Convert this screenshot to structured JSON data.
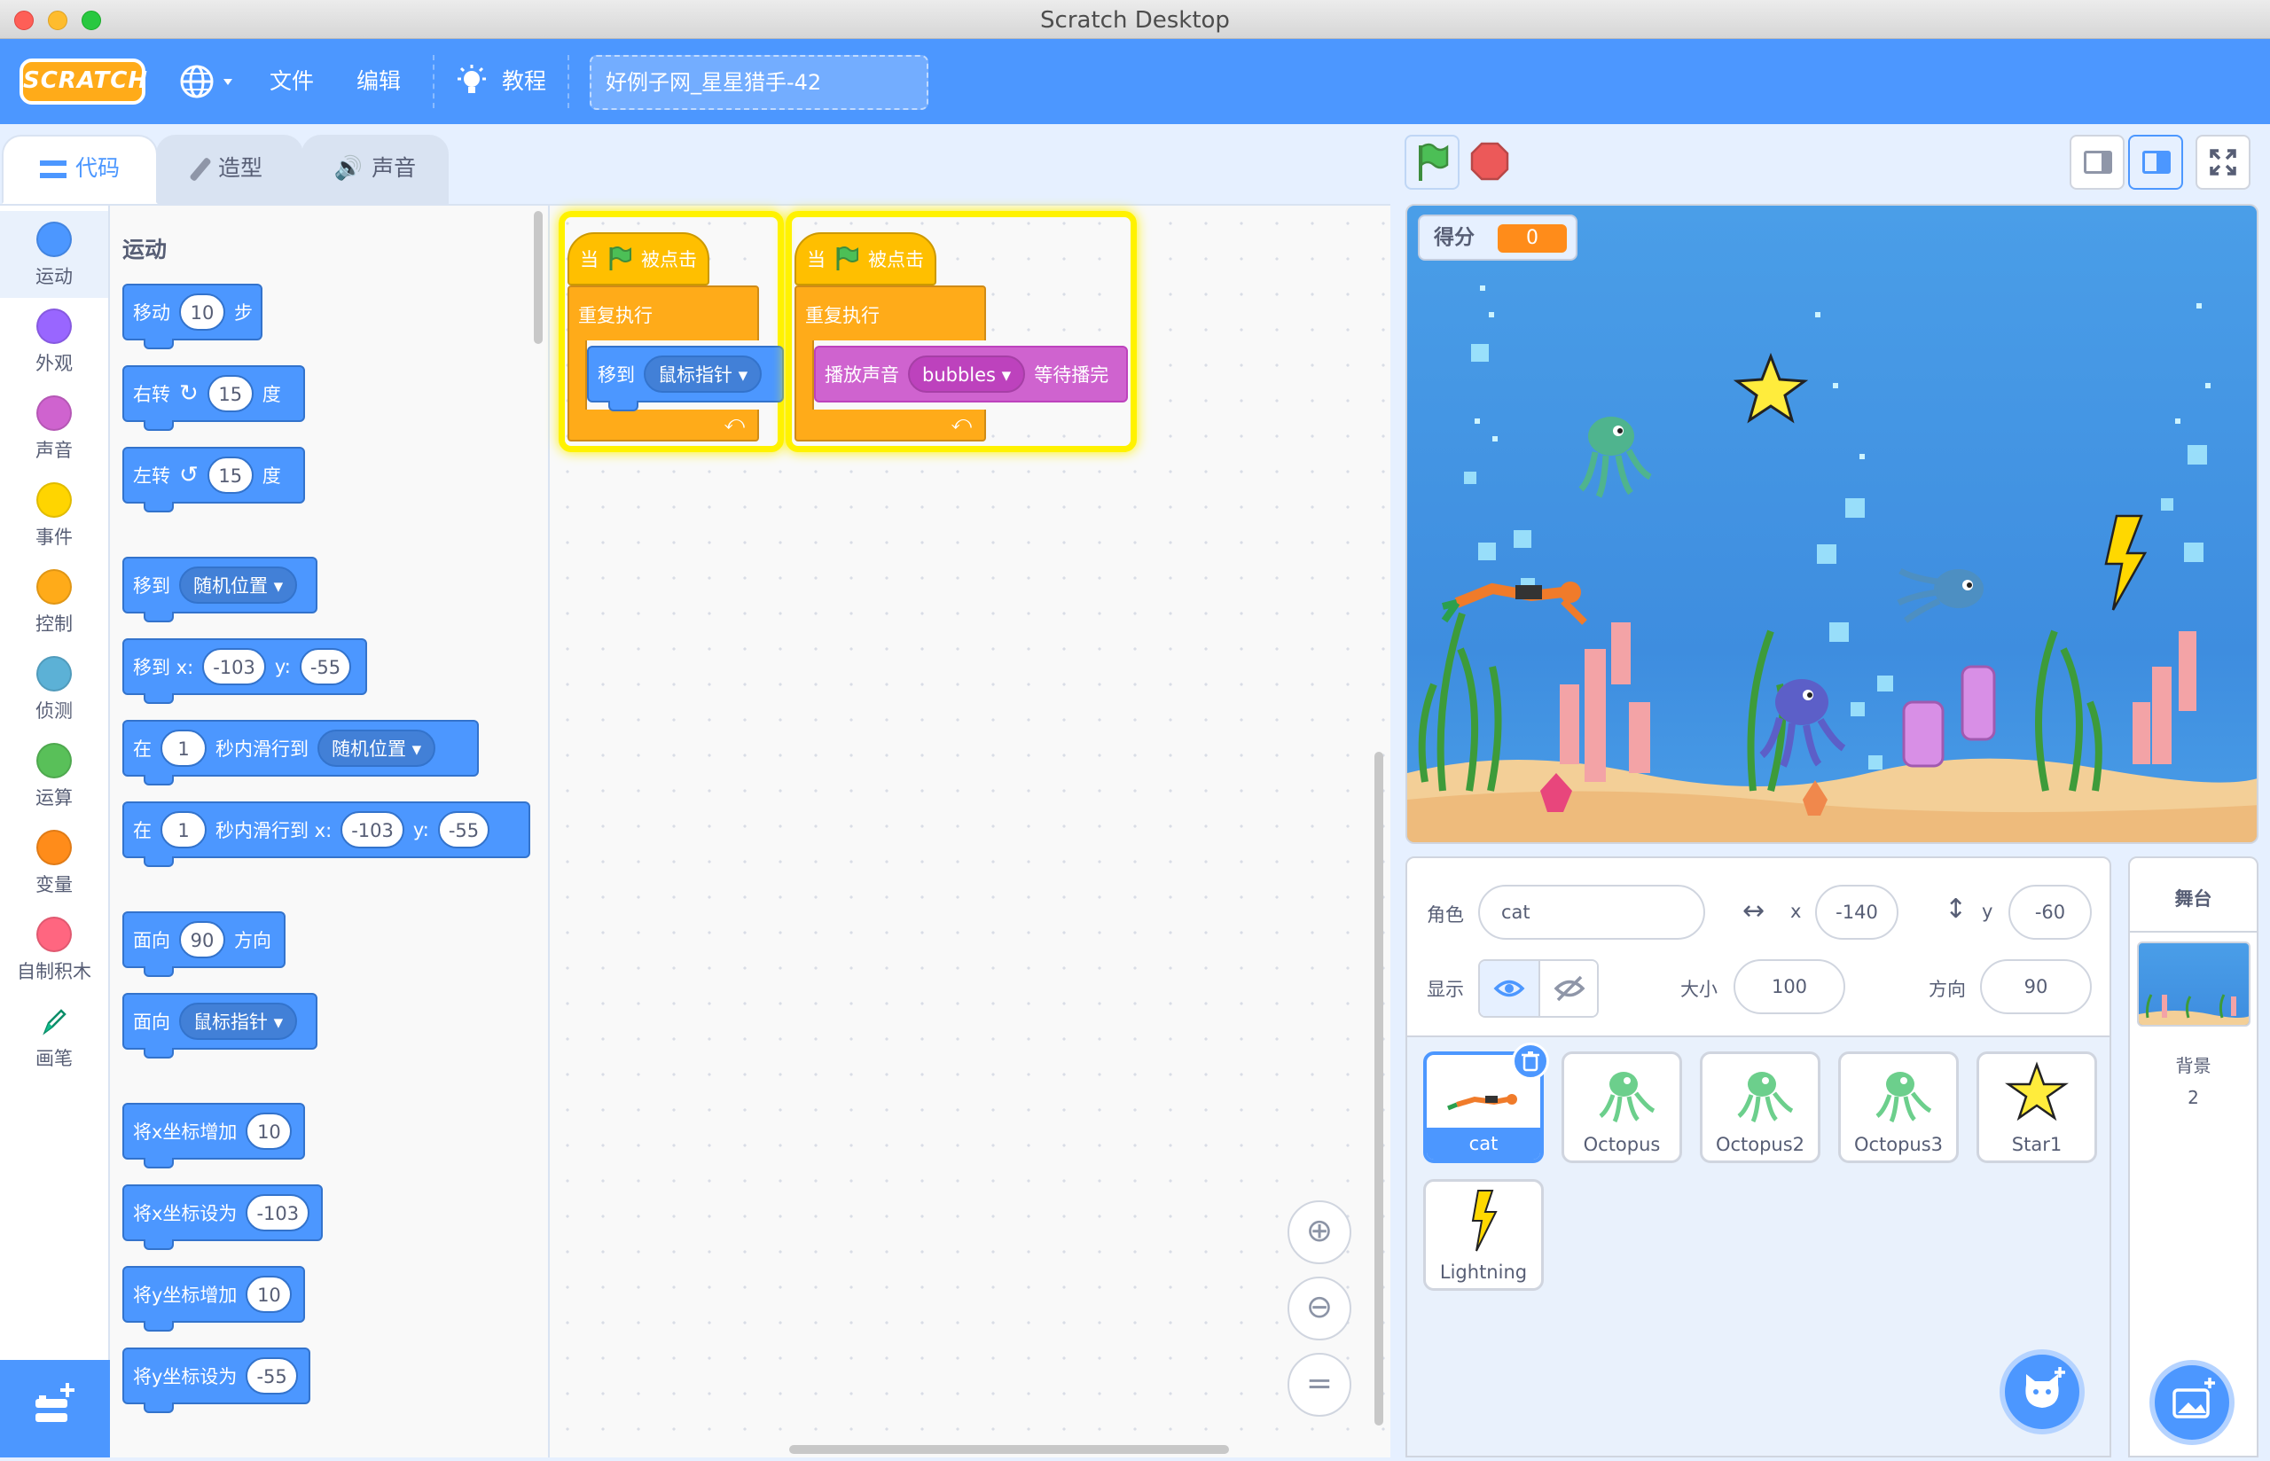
{
  "window": {
    "title": "Scratch Desktop"
  },
  "menubar": {
    "logo": "SCRATCH",
    "file": "文件",
    "edit": "编辑",
    "tutorials": "教程",
    "project_title": "好例子网_星星猎手-42"
  },
  "tabs": {
    "code": "代码",
    "costumes": "造型",
    "sounds": "声音"
  },
  "categories": [
    {
      "label": "运动",
      "color": "#4c97ff"
    },
    {
      "label": "外观",
      "color": "#9966ff"
    },
    {
      "label": "声音",
      "color": "#cf63cf"
    },
    {
      "label": "事件",
      "color": "#ffd500"
    },
    {
      "label": "控制",
      "color": "#ffab19"
    },
    {
      "label": "侦测",
      "color": "#5cb1d6"
    },
    {
      "label": "运算",
      "color": "#59c059"
    },
    {
      "label": "变量",
      "color": "#ff8c1a"
    },
    {
      "label": "自制积木",
      "color": "#ff6680"
    },
    {
      "label": "画笔",
      "color": "#0fbd8c"
    }
  ],
  "palette": {
    "heading": "运动",
    "move": {
      "a": "移动",
      "v": "10",
      "b": "步"
    },
    "turn_right": {
      "a": "右转",
      "v": "15",
      "b": "度"
    },
    "turn_left": {
      "a": "左转",
      "v": "15",
      "b": "度"
    },
    "goto": {
      "a": "移到",
      "dd": "随机位置"
    },
    "goto_xy": {
      "a": "移到 x:",
      "x": "-103",
      "y_lbl": "y:",
      "y": "-55"
    },
    "glide": {
      "a": "在",
      "v": "1",
      "b": "秒内滑行到",
      "dd": "随机位置"
    },
    "glide_xy": {
      "a": "在",
      "v": "1",
      "b": "秒内滑行到 x:",
      "x": "-103",
      "y_lbl": "y:",
      "y": "-55"
    },
    "point_dir": {
      "a": "面向",
      "v": "90",
      "b": "方向"
    },
    "point_towards": {
      "a": "面向",
      "dd": "鼠标指针"
    },
    "change_x": {
      "a": "将x坐标增加",
      "v": "10"
    },
    "set_x": {
      "a": "将x坐标设为",
      "v": "-103"
    },
    "change_y": {
      "a": "将y坐标增加",
      "v": "10"
    },
    "set_y": {
      "a": "将y坐标设为",
      "v": "-55"
    }
  },
  "scripts": [
    {
      "hat_a": "当",
      "hat_b": "被点击",
      "loop": "重复执行",
      "inner_a": "移到",
      "inner_dd": "鼠标指针"
    },
    {
      "hat_a": "当",
      "hat_b": "被点击",
      "loop": "重复执行",
      "inner_a": "播放声音",
      "inner_dd": "bubbles",
      "inner_b": "等待播完"
    }
  ],
  "stage": {
    "score_label": "得分",
    "score_value": "0"
  },
  "sprite_info": {
    "sprite_label": "角色",
    "sprite_name": "cat",
    "x_label": "x",
    "x": "-140",
    "y_label": "y",
    "y": "-60",
    "show_label": "显示",
    "size_label": "大小",
    "size": "100",
    "dir_label": "方向",
    "dir": "90"
  },
  "sprites": [
    "cat",
    "Octopus",
    "Octopus2",
    "Octopus3",
    "Star1",
    "Lightning"
  ],
  "stage_pane": {
    "title": "舞台",
    "backdrop_label": "背景",
    "backdrop_count": "2"
  }
}
